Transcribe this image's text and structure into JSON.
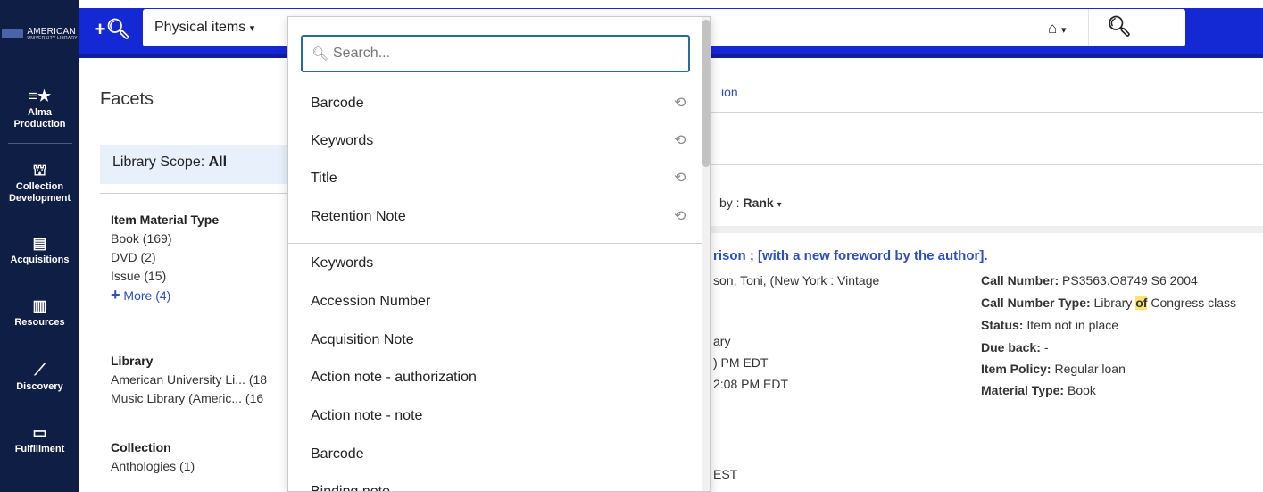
{
  "app": {
    "logo_text": "AMERICAN",
    "logo_sub": "UNIVERSITY LIBRARY"
  },
  "rail": {
    "items": [
      {
        "icon": "alma-production-icon",
        "label": "Alma Production"
      },
      {
        "icon": "collection-development-icon",
        "label": "Collection Development"
      },
      {
        "icon": "acquisitions-icon",
        "label": "Acquisitions"
      },
      {
        "icon": "resources-icon",
        "label": "Resources"
      },
      {
        "icon": "discovery-icon",
        "label": "Discovery"
      },
      {
        "icon": "fulfillment-icon",
        "label": "Fulfillment"
      }
    ]
  },
  "topbar": {
    "scope_label": "Physical items",
    "caret": "▾",
    "home_icon": "⌂"
  },
  "facets": {
    "title": "Facets",
    "library_scope_label": "Library Scope:",
    "library_scope_value": "All",
    "groups": [
      {
        "title": "Item Material Type",
        "items": [
          "Book (169)",
          "DVD (2)",
          "Issue (15)"
        ],
        "more": "More (4)"
      },
      {
        "title": "Library",
        "items": [
          "American University Li... (18",
          "Music Library (Americ... (16"
        ]
      },
      {
        "title": "Collection",
        "items": [
          "Anthologies (1)"
        ]
      }
    ]
  },
  "results": {
    "breadcrumb_fragment": "ion",
    "sort_label": "by :",
    "sort_value": "Rank",
    "record_title_fragment": "rison ; [with a new foreword by the author].",
    "author_fragment": "son, Toni, (New York : Vintage",
    "lines": [
      "ary",
      ") PM EDT",
      "2:08 PM EDT",
      "EST"
    ],
    "details": [
      {
        "label": "Call Number:",
        "value": "PS3563.O8749 S6 2004"
      },
      {
        "label": "Call Number Type:",
        "value_pre": "Library ",
        "value_hl": "of",
        "value_post": " Congress class"
      },
      {
        "label": "Status:",
        "value": "Item not in place"
      },
      {
        "label": "Due back:",
        "value": "-"
      },
      {
        "label": "Item Policy:",
        "value": "Regular loan"
      },
      {
        "label": "Material Type:",
        "value": "Book"
      }
    ]
  },
  "dropdown": {
    "search_placeholder": "Search...",
    "recent": [
      "Barcode",
      "Keywords",
      "Title",
      "Retention Note"
    ],
    "fields": [
      "Keywords",
      "Accession Number",
      "Acquisition Note",
      "Action note - authorization",
      "Action note - note",
      "Barcode",
      "Binding note"
    ]
  }
}
